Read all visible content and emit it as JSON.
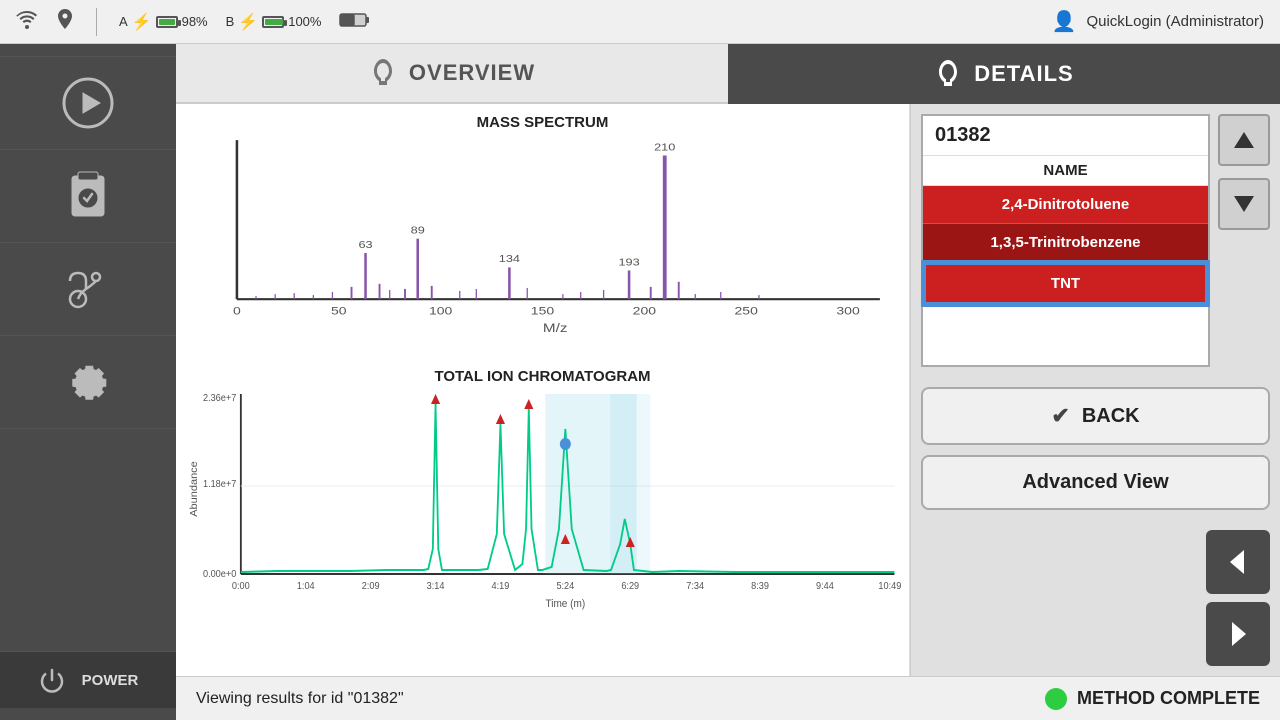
{
  "statusBar": {
    "batteryA_label": "A",
    "batteryA_pct": "98%",
    "batteryB_label": "B",
    "batteryB_pct": "100%",
    "user_icon": "👤",
    "user_label": "QuickLogin (Administrator)"
  },
  "tabs": [
    {
      "id": "overview",
      "label": "OVERVIEW",
      "active": false
    },
    {
      "id": "details",
      "label": "DETAILS",
      "active": true
    }
  ],
  "massSpectrum": {
    "title": "MASS SPECTRUM",
    "xLabel": "M/z",
    "peaks": [
      {
        "mz": 63,
        "label": "63",
        "rel": 0.32
      },
      {
        "mz": 89,
        "label": "89",
        "rel": 0.42
      },
      {
        "mz": 134,
        "label": "134",
        "rel": 0.22
      },
      {
        "mz": 193,
        "label": "193",
        "rel": 0.2
      },
      {
        "mz": 210,
        "label": "210",
        "rel": 1.0
      }
    ],
    "xTicks": [
      "0",
      "50",
      "100",
      "150",
      "200",
      "250",
      "300"
    ]
  },
  "tic": {
    "title": "TOTAL ION CHROMATOGRAM",
    "yAxisLabel": "Abundance",
    "yMax": "2.36e+7",
    "yMid": "1.18e+7",
    "yMin": "0.00e+0",
    "xTicks": [
      "0:00",
      "1:04",
      "2:09",
      "3:14",
      "4:19",
      "5:24",
      "6:29",
      "7:34",
      "8:39",
      "9:44",
      "10:49"
    ],
    "xLabel": "Time (m)"
  },
  "results": {
    "id": "01382",
    "nameHeader": "NAME",
    "items": [
      {
        "name": "2,4-Dinitrotoluene",
        "style": "red"
      },
      {
        "name": "1,3,5-Trinitrobenzene",
        "style": "dark-red"
      },
      {
        "name": "TNT",
        "style": "selected"
      }
    ]
  },
  "buttons": {
    "back": "BACK",
    "advancedView": "Advanced View"
  },
  "statusBottom": {
    "viewing": "Viewing results for id \"01382\"",
    "methodComplete": "METHOD COMPLETE"
  },
  "sidebar": {
    "powerLabel": "POWER"
  }
}
